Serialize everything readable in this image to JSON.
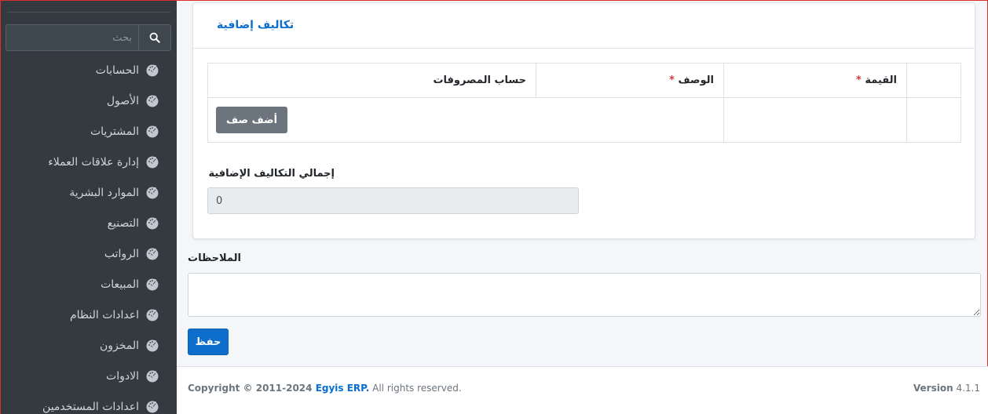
{
  "sidebar": {
    "search_placeholder": "بحث",
    "items": [
      {
        "label": "الحسابات"
      },
      {
        "label": "الأصول"
      },
      {
        "label": "المشتريات"
      },
      {
        "label": "إدارة علاقات العملاء"
      },
      {
        "label": "الموارد البشرية"
      },
      {
        "label": "التصنيع"
      },
      {
        "label": "الرواتب"
      },
      {
        "label": "المبيعات"
      },
      {
        "label": "اعدادات النظام"
      },
      {
        "label": "المخزون"
      },
      {
        "label": "الادوات"
      },
      {
        "label": "اعدادات المستخدمين"
      }
    ]
  },
  "card": {
    "title": "تكاليف إضافية",
    "table": {
      "columns": [
        "القيمة",
        "الوصف",
        "حساب المصروفات"
      ],
      "required_mark": "*"
    },
    "add_row_label": "أضف صف",
    "total_label": "إجمالي التكاليف الإضافية",
    "total_value": "0"
  },
  "notes": {
    "label": "الملاحظات",
    "value": ""
  },
  "save_label": "حفظ",
  "footer": {
    "copyright": "Copyright © 2011-2024",
    "brand": "Egyis ERP.",
    "rights": " All rights reserved.",
    "version_label": "Version",
    "version": "4.1.1"
  },
  "colors": {
    "sidebar_bg": "#343a40",
    "link_blue": "#0a6ed1",
    "save_button": "#0d6ecb",
    "add_row_button": "#6c757d",
    "required": "#dc3545"
  }
}
